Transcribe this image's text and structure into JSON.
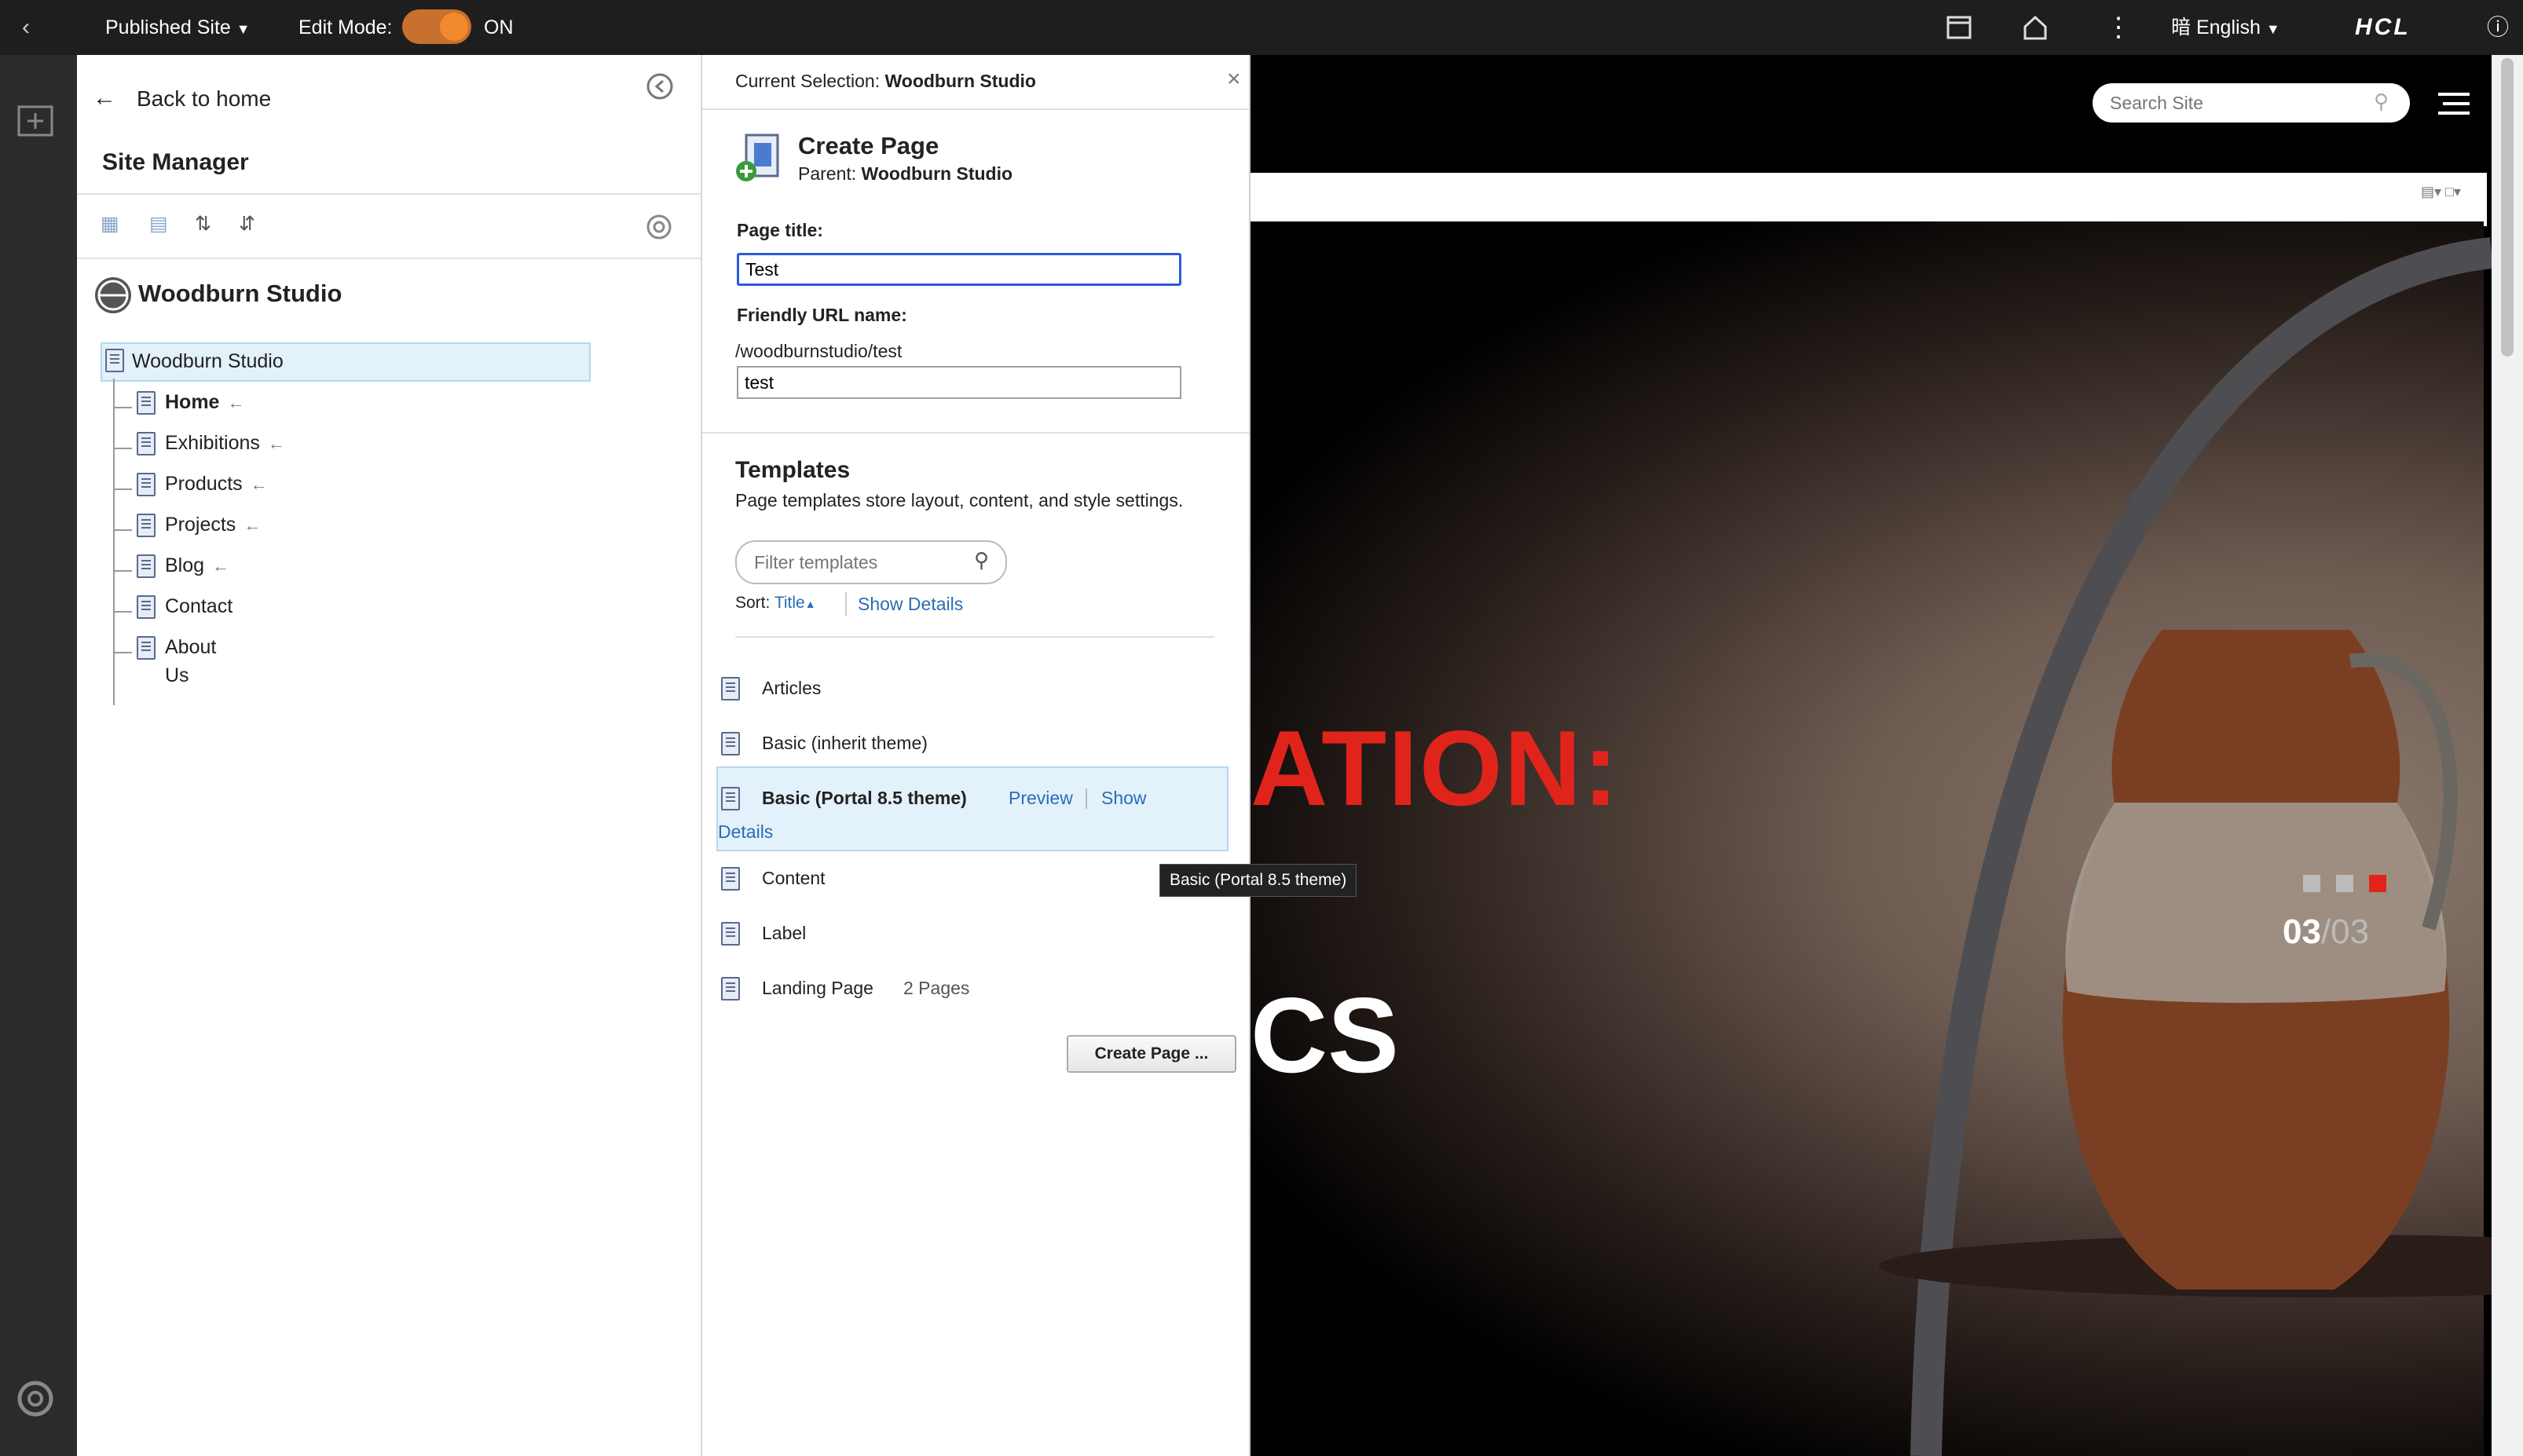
{
  "topbar": {
    "site_selector": "Published Site",
    "edit_mode_label": "Edit Mode:",
    "edit_mode_state": "ON",
    "language": "English",
    "brand": "HCL",
    "accent_color": "#f08a2d"
  },
  "site_manager": {
    "back_label": "Back to home",
    "title": "Site Manager",
    "site_name": "Woodburn Studio",
    "tree_root": "Woodburn Studio",
    "tree_items": [
      {
        "label": "Home",
        "bold": true,
        "arrow": "←"
      },
      {
        "label": "Exhibitions",
        "arrow": "←"
      },
      {
        "label": "Products",
        "arrow": "←"
      },
      {
        "label": "Projects",
        "arrow": "←"
      },
      {
        "label": "Blog",
        "arrow": "←"
      },
      {
        "label": "Contact",
        "arrow": ""
      },
      {
        "label": "About Us",
        "arrow": ""
      }
    ]
  },
  "create_page": {
    "current_selection_label": "Current Selection:",
    "current_selection_value": "Woodburn Studio",
    "close": "×",
    "heading": "Create Page",
    "parent_label": "Parent:",
    "parent_value": "Woodburn Studio",
    "page_title_label": "Page title:",
    "page_title_value": "Test",
    "friendly_url_label": "Friendly URL name:",
    "friendly_url_path": "/woodburnstudio/test",
    "friendly_url_value": "test",
    "templates_heading": "Templates",
    "templates_desc": "Page templates store layout, content, and style settings.",
    "filter_placeholder": "Filter templates",
    "sort_label": "Sort:",
    "sort_value": "Title",
    "show_details": "Show Details",
    "templates": [
      {
        "name": "Articles"
      },
      {
        "name": "Basic (inherit theme)"
      },
      {
        "name": "Basic (Portal 8.5 theme)",
        "selected": true,
        "preview": "Preview",
        "show": "Show",
        "details": "Details"
      },
      {
        "name": "Content"
      },
      {
        "name": "Label"
      },
      {
        "name": "Landing Page",
        "count": "2 Pages"
      }
    ],
    "tooltip": "Basic (Portal 8.5 theme)",
    "create_button": "Create Page ..."
  },
  "preview": {
    "search_placeholder": "Search Site",
    "hero_text_1": "ATION:",
    "hero_text_2": "CS",
    "slide_current": "03",
    "slide_total": "/03"
  }
}
